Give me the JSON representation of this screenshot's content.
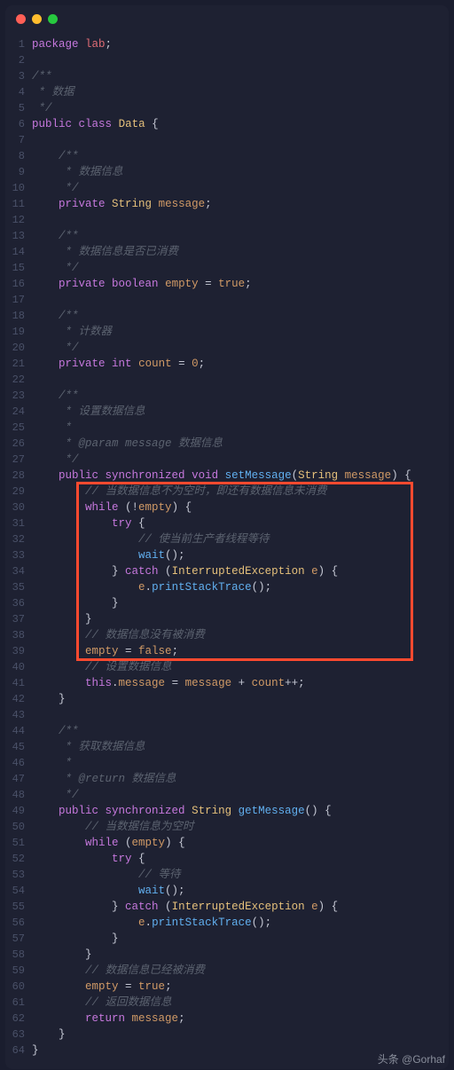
{
  "window": {
    "traffic_lights": {
      "close": "#ff5f56",
      "min": "#ffbd2e",
      "max": "#27c93f"
    }
  },
  "code": {
    "lines": [
      {
        "n": 1,
        "tokens": [
          [
            "kw",
            "package"
          ],
          [
            "plain",
            " "
          ],
          [
            "id",
            "lab"
          ],
          [
            "op",
            ";"
          ]
        ]
      },
      {
        "n": 2,
        "tokens": []
      },
      {
        "n": 3,
        "tokens": [
          [
            "com",
            "/**"
          ]
        ]
      },
      {
        "n": 4,
        "tokens": [
          [
            "com",
            " * 数据"
          ]
        ]
      },
      {
        "n": 5,
        "tokens": [
          [
            "com",
            " */"
          ]
        ]
      },
      {
        "n": 6,
        "tokens": [
          [
            "kw",
            "public"
          ],
          [
            "plain",
            " "
          ],
          [
            "kw",
            "class"
          ],
          [
            "plain",
            " "
          ],
          [
            "type",
            "Data"
          ],
          [
            "plain",
            " {"
          ]
        ]
      },
      {
        "n": 7,
        "tokens": []
      },
      {
        "n": 8,
        "tokens": [
          [
            "plain",
            "    "
          ],
          [
            "com",
            "/**"
          ]
        ]
      },
      {
        "n": 9,
        "tokens": [
          [
            "plain",
            "    "
          ],
          [
            "com",
            " * 数据信息"
          ]
        ]
      },
      {
        "n": 10,
        "tokens": [
          [
            "plain",
            "    "
          ],
          [
            "com",
            " */"
          ]
        ]
      },
      {
        "n": 11,
        "tokens": [
          [
            "plain",
            "    "
          ],
          [
            "kw",
            "private"
          ],
          [
            "plain",
            " "
          ],
          [
            "type",
            "String"
          ],
          [
            "plain",
            " "
          ],
          [
            "var",
            "message"
          ],
          [
            "op",
            ";"
          ]
        ]
      },
      {
        "n": 12,
        "tokens": []
      },
      {
        "n": 13,
        "tokens": [
          [
            "plain",
            "    "
          ],
          [
            "com",
            "/**"
          ]
        ]
      },
      {
        "n": 14,
        "tokens": [
          [
            "plain",
            "    "
          ],
          [
            "com",
            " * 数据信息是否已消费"
          ]
        ]
      },
      {
        "n": 15,
        "tokens": [
          [
            "plain",
            "    "
          ],
          [
            "com",
            " */"
          ]
        ]
      },
      {
        "n": 16,
        "tokens": [
          [
            "plain",
            "    "
          ],
          [
            "kw",
            "private"
          ],
          [
            "plain",
            " "
          ],
          [
            "kw",
            "boolean"
          ],
          [
            "plain",
            " "
          ],
          [
            "var",
            "empty"
          ],
          [
            "plain",
            " = "
          ],
          [
            "bool",
            "true"
          ],
          [
            "op",
            ";"
          ]
        ]
      },
      {
        "n": 17,
        "tokens": []
      },
      {
        "n": 18,
        "tokens": [
          [
            "plain",
            "    "
          ],
          [
            "com",
            "/**"
          ]
        ]
      },
      {
        "n": 19,
        "tokens": [
          [
            "plain",
            "    "
          ],
          [
            "com",
            " * 计数器"
          ]
        ]
      },
      {
        "n": 20,
        "tokens": [
          [
            "plain",
            "    "
          ],
          [
            "com",
            " */"
          ]
        ]
      },
      {
        "n": 21,
        "tokens": [
          [
            "plain",
            "    "
          ],
          [
            "kw",
            "private"
          ],
          [
            "plain",
            " "
          ],
          [
            "kw",
            "int"
          ],
          [
            "plain",
            " "
          ],
          [
            "var",
            "count"
          ],
          [
            "plain",
            " = "
          ],
          [
            "num",
            "0"
          ],
          [
            "op",
            ";"
          ]
        ]
      },
      {
        "n": 22,
        "tokens": []
      },
      {
        "n": 23,
        "tokens": [
          [
            "plain",
            "    "
          ],
          [
            "com",
            "/**"
          ]
        ]
      },
      {
        "n": 24,
        "tokens": [
          [
            "plain",
            "    "
          ],
          [
            "com",
            " * 设置数据信息"
          ]
        ]
      },
      {
        "n": 25,
        "tokens": [
          [
            "plain",
            "    "
          ],
          [
            "com",
            " *"
          ]
        ]
      },
      {
        "n": 26,
        "tokens": [
          [
            "plain",
            "    "
          ],
          [
            "com",
            " * @param message 数据信息"
          ]
        ]
      },
      {
        "n": 27,
        "tokens": [
          [
            "plain",
            "    "
          ],
          [
            "com",
            " */"
          ]
        ]
      },
      {
        "n": 28,
        "tokens": [
          [
            "plain",
            "    "
          ],
          [
            "kw",
            "public"
          ],
          [
            "plain",
            " "
          ],
          [
            "kw",
            "synchronized"
          ],
          [
            "plain",
            " "
          ],
          [
            "kw",
            "void"
          ],
          [
            "plain",
            " "
          ],
          [
            "fn",
            "setMessage"
          ],
          [
            "plain",
            "("
          ],
          [
            "type",
            "String"
          ],
          [
            "plain",
            " "
          ],
          [
            "var",
            "message"
          ],
          [
            "plain",
            ") {"
          ]
        ]
      },
      {
        "n": 29,
        "tokens": [
          [
            "plain",
            "        "
          ],
          [
            "com",
            "// 当数据信息不为空时，即还有数据信息未消费"
          ]
        ]
      },
      {
        "n": 30,
        "tokens": [
          [
            "plain",
            "        "
          ],
          [
            "kw",
            "while"
          ],
          [
            "plain",
            " (!"
          ],
          [
            "var",
            "empty"
          ],
          [
            "plain",
            ") {"
          ]
        ]
      },
      {
        "n": 31,
        "tokens": [
          [
            "plain",
            "            "
          ],
          [
            "kw",
            "try"
          ],
          [
            "plain",
            " {"
          ]
        ]
      },
      {
        "n": 32,
        "tokens": [
          [
            "plain",
            "                "
          ],
          [
            "com",
            "// 使当前生产者线程等待"
          ]
        ]
      },
      {
        "n": 33,
        "tokens": [
          [
            "plain",
            "                "
          ],
          [
            "fn",
            "wait"
          ],
          [
            "plain",
            "();"
          ]
        ]
      },
      {
        "n": 34,
        "tokens": [
          [
            "plain",
            "            } "
          ],
          [
            "kw",
            "catch"
          ],
          [
            "plain",
            " ("
          ],
          [
            "type",
            "InterruptedException"
          ],
          [
            "plain",
            " "
          ],
          [
            "var",
            "e"
          ],
          [
            "plain",
            ") {"
          ]
        ]
      },
      {
        "n": 35,
        "tokens": [
          [
            "plain",
            "                "
          ],
          [
            "var",
            "e"
          ],
          [
            "plain",
            "."
          ],
          [
            "fn",
            "printStackTrace"
          ],
          [
            "plain",
            "();"
          ]
        ]
      },
      {
        "n": 36,
        "tokens": [
          [
            "plain",
            "            }"
          ]
        ]
      },
      {
        "n": 37,
        "tokens": [
          [
            "plain",
            "        }"
          ]
        ]
      },
      {
        "n": 38,
        "tokens": [
          [
            "plain",
            "        "
          ],
          [
            "com",
            "// 数据信息没有被消费"
          ]
        ]
      },
      {
        "n": 39,
        "tokens": [
          [
            "plain",
            "        "
          ],
          [
            "var",
            "empty"
          ],
          [
            "plain",
            " = "
          ],
          [
            "bool",
            "false"
          ],
          [
            "op",
            ";"
          ]
        ]
      },
      {
        "n": 40,
        "tokens": [
          [
            "plain",
            "        "
          ],
          [
            "com",
            "// 设置数据信息"
          ]
        ]
      },
      {
        "n": 41,
        "tokens": [
          [
            "plain",
            "        "
          ],
          [
            "kw",
            "this"
          ],
          [
            "plain",
            "."
          ],
          [
            "var",
            "message"
          ],
          [
            "plain",
            " = "
          ],
          [
            "var",
            "message"
          ],
          [
            "plain",
            " + "
          ],
          [
            "var",
            "count"
          ],
          [
            "plain",
            "++;"
          ]
        ]
      },
      {
        "n": 42,
        "tokens": [
          [
            "plain",
            "    }"
          ]
        ]
      },
      {
        "n": 43,
        "tokens": []
      },
      {
        "n": 44,
        "tokens": [
          [
            "plain",
            "    "
          ],
          [
            "com",
            "/**"
          ]
        ]
      },
      {
        "n": 45,
        "tokens": [
          [
            "plain",
            "    "
          ],
          [
            "com",
            " * 获取数据信息"
          ]
        ]
      },
      {
        "n": 46,
        "tokens": [
          [
            "plain",
            "    "
          ],
          [
            "com",
            " *"
          ]
        ]
      },
      {
        "n": 47,
        "tokens": [
          [
            "plain",
            "    "
          ],
          [
            "com",
            " * @return 数据信息"
          ]
        ]
      },
      {
        "n": 48,
        "tokens": [
          [
            "plain",
            "    "
          ],
          [
            "com",
            " */"
          ]
        ]
      },
      {
        "n": 49,
        "tokens": [
          [
            "plain",
            "    "
          ],
          [
            "kw",
            "public"
          ],
          [
            "plain",
            " "
          ],
          [
            "kw",
            "synchronized"
          ],
          [
            "plain",
            " "
          ],
          [
            "type",
            "String"
          ],
          [
            "plain",
            " "
          ],
          [
            "fn",
            "getMessage"
          ],
          [
            "plain",
            "() {"
          ]
        ]
      },
      {
        "n": 50,
        "tokens": [
          [
            "plain",
            "        "
          ],
          [
            "com",
            "// 当数据信息为空时"
          ]
        ]
      },
      {
        "n": 51,
        "tokens": [
          [
            "plain",
            "        "
          ],
          [
            "kw",
            "while"
          ],
          [
            "plain",
            " ("
          ],
          [
            "var",
            "empty"
          ],
          [
            "plain",
            ") {"
          ]
        ]
      },
      {
        "n": 52,
        "tokens": [
          [
            "plain",
            "            "
          ],
          [
            "kw",
            "try"
          ],
          [
            "plain",
            " {"
          ]
        ]
      },
      {
        "n": 53,
        "tokens": [
          [
            "plain",
            "                "
          ],
          [
            "com",
            "// 等待"
          ]
        ]
      },
      {
        "n": 54,
        "tokens": [
          [
            "plain",
            "                "
          ],
          [
            "fn",
            "wait"
          ],
          [
            "plain",
            "();"
          ]
        ]
      },
      {
        "n": 55,
        "tokens": [
          [
            "plain",
            "            } "
          ],
          [
            "kw",
            "catch"
          ],
          [
            "plain",
            " ("
          ],
          [
            "type",
            "InterruptedException"
          ],
          [
            "plain",
            " "
          ],
          [
            "var",
            "e"
          ],
          [
            "plain",
            ") {"
          ]
        ]
      },
      {
        "n": 56,
        "tokens": [
          [
            "plain",
            "                "
          ],
          [
            "var",
            "e"
          ],
          [
            "plain",
            "."
          ],
          [
            "fn",
            "printStackTrace"
          ],
          [
            "plain",
            "();"
          ]
        ]
      },
      {
        "n": 57,
        "tokens": [
          [
            "plain",
            "            }"
          ]
        ]
      },
      {
        "n": 58,
        "tokens": [
          [
            "plain",
            "        }"
          ]
        ]
      },
      {
        "n": 59,
        "tokens": [
          [
            "plain",
            "        "
          ],
          [
            "com",
            "// 数据信息已经被消费"
          ]
        ]
      },
      {
        "n": 60,
        "tokens": [
          [
            "plain",
            "        "
          ],
          [
            "var",
            "empty"
          ],
          [
            "plain",
            " = "
          ],
          [
            "bool",
            "true"
          ],
          [
            "op",
            ";"
          ]
        ]
      },
      {
        "n": 61,
        "tokens": [
          [
            "plain",
            "        "
          ],
          [
            "com",
            "// 返回数据信息"
          ]
        ]
      },
      {
        "n": 62,
        "tokens": [
          [
            "plain",
            "        "
          ],
          [
            "kw",
            "return"
          ],
          [
            "plain",
            " "
          ],
          [
            "var",
            "message"
          ],
          [
            "op",
            ";"
          ]
        ]
      },
      {
        "n": 63,
        "tokens": [
          [
            "plain",
            "    }"
          ]
        ]
      },
      {
        "n": 64,
        "tokens": [
          [
            "plain",
            "}"
          ]
        ]
      }
    ],
    "highlight": {
      "from": 29,
      "to": 39
    }
  },
  "footer": "头条 @Gorhaf"
}
